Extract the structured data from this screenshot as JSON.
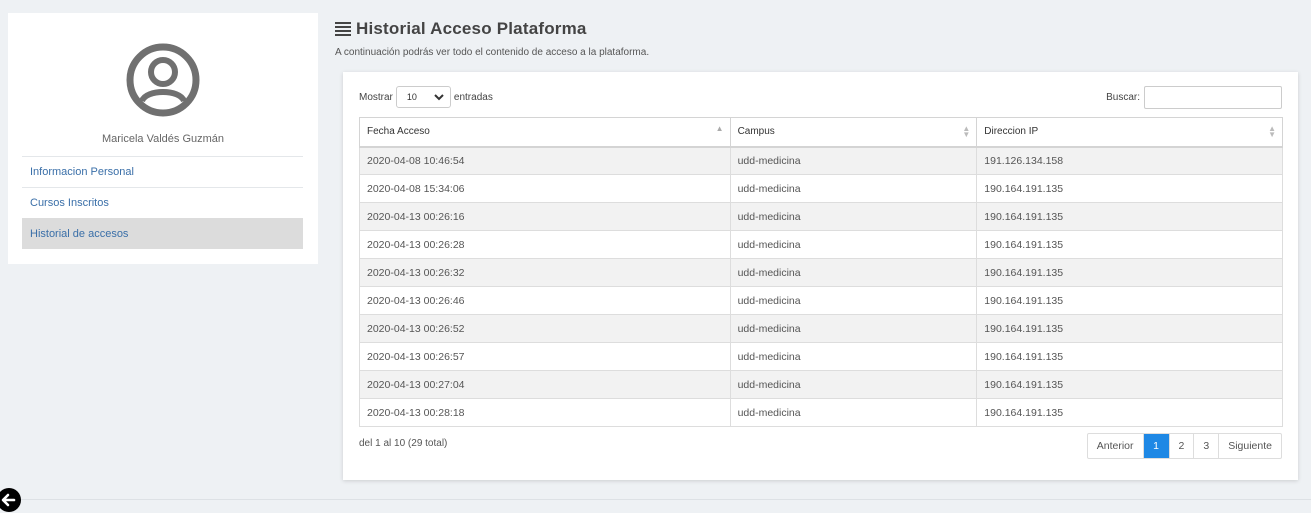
{
  "sidebar": {
    "user_name": "Maricela Valdés Guzmán",
    "items": [
      {
        "label": "Informacion Personal"
      },
      {
        "label": "Cursos Inscritos"
      },
      {
        "label": "Historial de accesos",
        "active": true
      }
    ]
  },
  "header": {
    "title": "Historial Acceso Plataforma",
    "subtitle": "A continuación podrás ver todo el contenido de acceso a la plataforma.",
    "icon": "list-icon"
  },
  "table_controls": {
    "show_label": "Mostrar",
    "page_size": "10",
    "entries_label": "entradas",
    "search_label": "Buscar:",
    "search_value": ""
  },
  "table": {
    "columns": [
      "Fecha Acceso",
      "Campus",
      "Direccion IP"
    ],
    "rows": [
      [
        "2020-04-08 10:46:54",
        "udd-medicina",
        "191.126.134.158"
      ],
      [
        "2020-04-08 15:34:06",
        "udd-medicina",
        "190.164.191.135"
      ],
      [
        "2020-04-13 00:26:16",
        "udd-medicina",
        "190.164.191.135"
      ],
      [
        "2020-04-13 00:26:28",
        "udd-medicina",
        "190.164.191.135"
      ],
      [
        "2020-04-13 00:26:32",
        "udd-medicina",
        "190.164.191.135"
      ],
      [
        "2020-04-13 00:26:46",
        "udd-medicina",
        "190.164.191.135"
      ],
      [
        "2020-04-13 00:26:52",
        "udd-medicina",
        "190.164.191.135"
      ],
      [
        "2020-04-13 00:26:57",
        "udd-medicina",
        "190.164.191.135"
      ],
      [
        "2020-04-13 00:27:04",
        "udd-medicina",
        "190.164.191.135"
      ],
      [
        "2020-04-13 00:28:18",
        "udd-medicina",
        "190.164.191.135"
      ]
    ]
  },
  "footer": {
    "info": "del 1 al 10 (29 total)",
    "pagination": {
      "prev": "Anterior",
      "pages": [
        "1",
        "2",
        "3"
      ],
      "current": "1",
      "next": "Siguiente"
    }
  },
  "colors": {
    "accent": "#1e88e5",
    "link": "#3a6fa8",
    "background": "#eef1f4"
  }
}
